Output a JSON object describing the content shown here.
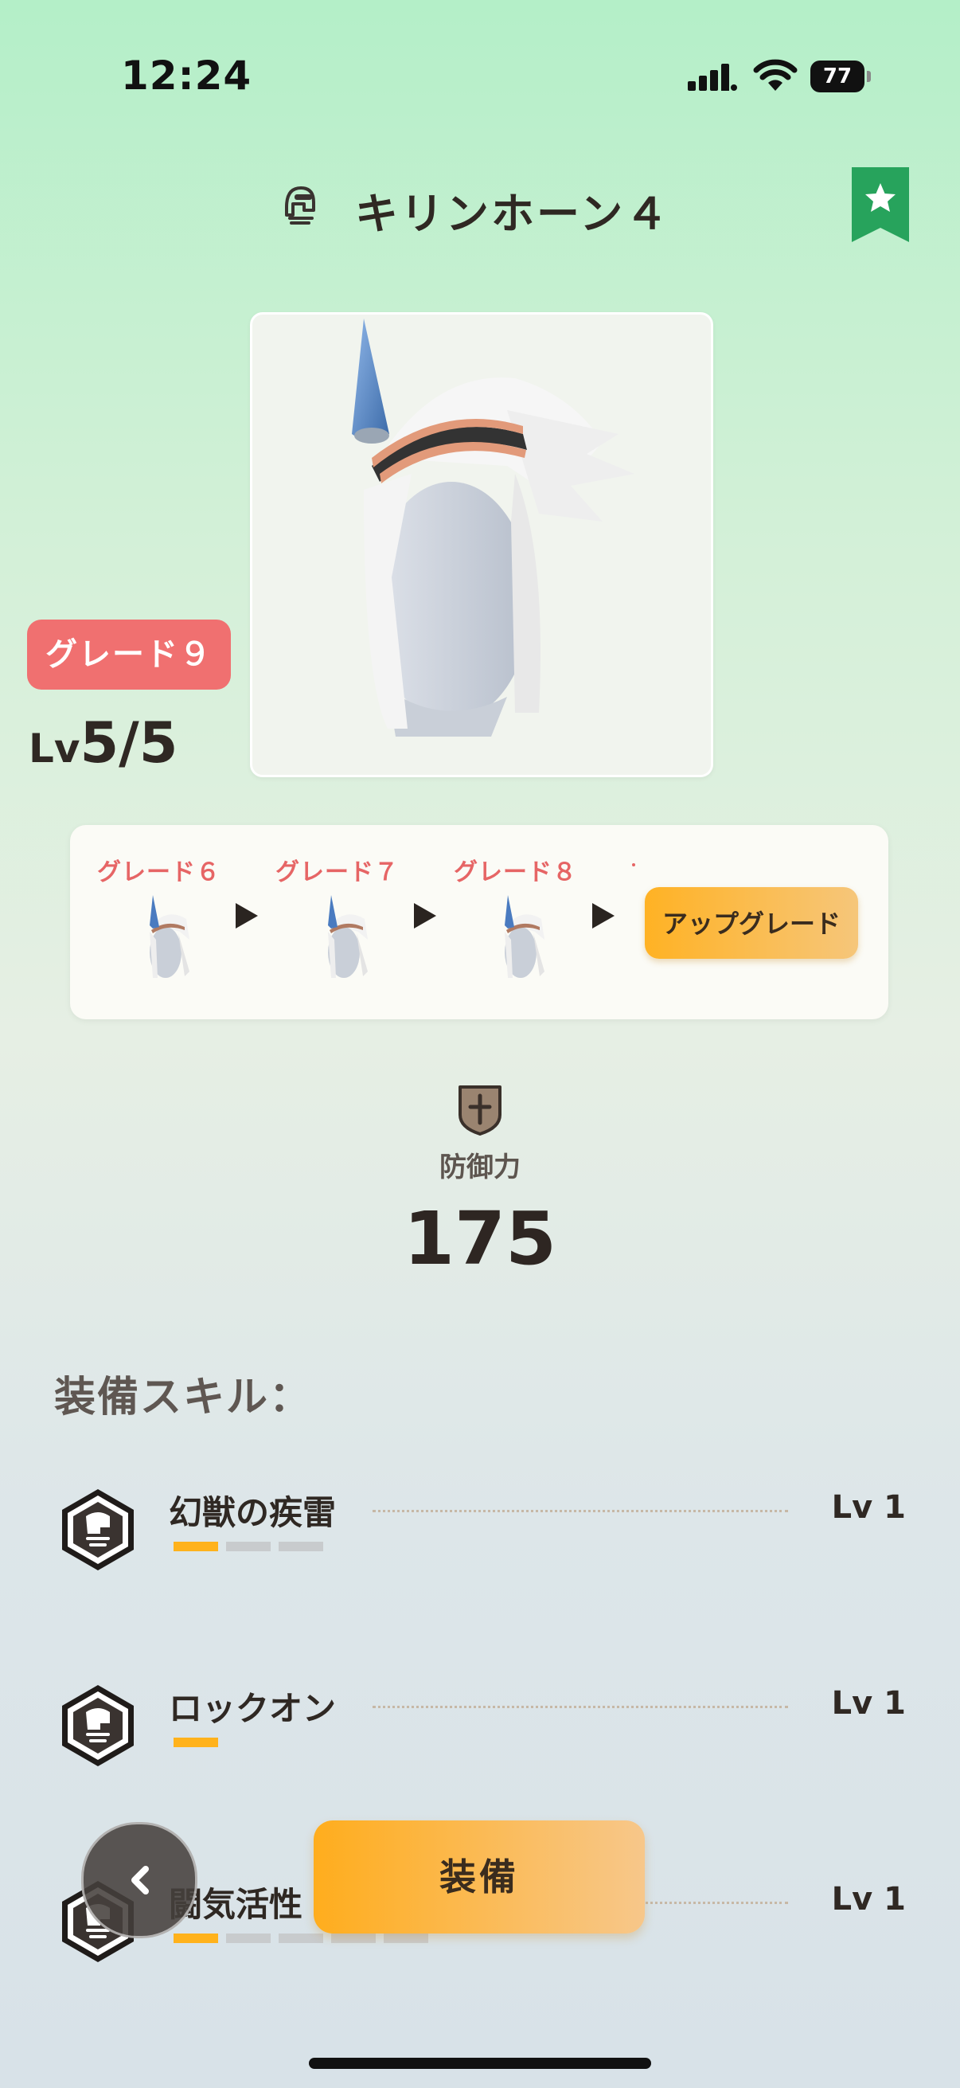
{
  "status_bar": {
    "time": "12:24",
    "battery": "77"
  },
  "header": {
    "title": "キリンホーン４",
    "icon": "helmet-icon",
    "favorite_icon": "star-bookmark-icon"
  },
  "item": {
    "grade_badge": "グレード９",
    "level_prefix": "Lv",
    "level_value": "5/5"
  },
  "upgrade_path": {
    "steps": [
      {
        "label": "グレード６"
      },
      {
        "label": "グレード７"
      },
      {
        "label": "グレード８"
      }
    ],
    "button_label": "アップグレード"
  },
  "stats": {
    "defense_label": "防御力",
    "defense_value": "175"
  },
  "skills_title": "装備スキル：",
  "skills": [
    {
      "name": "幻獣の疾雷",
      "level": "Lv 1",
      "max": 3,
      "current": 1
    },
    {
      "name": "ロックオン",
      "level": "Lv 1",
      "max": 1,
      "current": 1
    },
    {
      "name": "闘気活性",
      "level": "Lv 1",
      "max": 5,
      "current": 1
    }
  ],
  "actions": {
    "equip_label": "装備",
    "back_icon": "chevron-left-icon"
  },
  "colors": {
    "accent_orange": "#ffb21c",
    "grade_red": "#f07070",
    "bookmark_green": "#27a35c"
  }
}
